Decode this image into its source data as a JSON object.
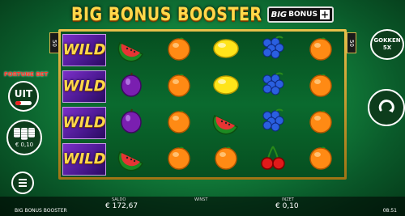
{
  "header": {
    "title": "BIG BONUS BOOSTER",
    "badge_big": "BIG",
    "badge_bonus": "BONUS",
    "badge_plus": "+"
  },
  "paylines": {
    "left": "50",
    "right": "50"
  },
  "reels": {
    "grid": [
      [
        "wild",
        "watermelon",
        "orange",
        "lemon",
        "grapes",
        "orange"
      ],
      [
        "wild",
        "plum",
        "orange",
        "lemon",
        "grapes",
        "orange"
      ],
      [
        "wild",
        "plum",
        "orange",
        "watermelon",
        "grapes",
        "orange"
      ],
      [
        "wild",
        "watermelon",
        "orange",
        "orange",
        "cherries",
        "orange"
      ]
    ],
    "wild_label": "WILD"
  },
  "left_panel": {
    "fortune_bet_label": "FORTUNE BET",
    "fortune_bet_state": "UIT",
    "bet_value": "€ 0,10"
  },
  "right_panel": {
    "autoplay_label": "GOKKEN",
    "autoplay_count": "5X"
  },
  "bottom_bar": {
    "saldo_label": "SALDO",
    "saldo_value": "€ 172,67",
    "winst_label": "WINST",
    "inzet_label": "INZET",
    "inzet_value": "€ 0,10",
    "game_name": "BIG BONUS BOOSTER",
    "clock": "08:51"
  },
  "colors": {
    "background": "#148a40",
    "title_gold": "#ffd84a",
    "frame_gold": "#e8c04a",
    "wild_purple": "#7b2fc8"
  }
}
